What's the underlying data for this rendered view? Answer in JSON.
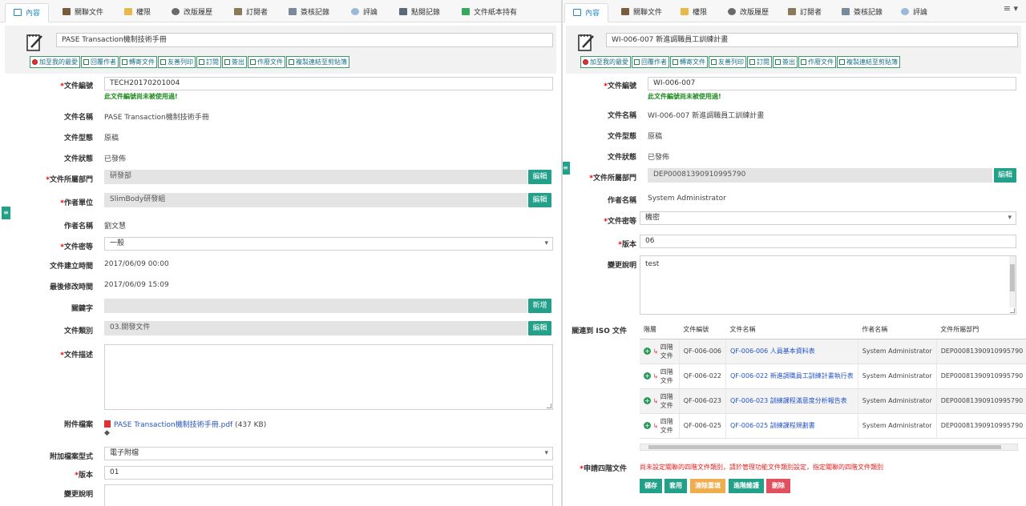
{
  "left": {
    "tabs": [
      "內容",
      "關聯文件",
      "權限",
      "改版履歷",
      "訂閱者",
      "簽核記錄",
      "評論",
      "點閱記錄",
      "文件紙本持有"
    ],
    "title": "PASE Transaction機制技術手冊",
    "actions": [
      "加至我的最愛",
      "回覆作者",
      "轉寄文件",
      "友善列印",
      "訂閱",
      "簽出",
      "作廢文件",
      "複製連結至剪貼簿"
    ],
    "fields": {
      "doc_no_label": "文件編號",
      "doc_no": "TECH20170201004",
      "doc_no_ok": "此文件編號尚未被使用過!",
      "doc_name_label": "文件名稱",
      "doc_name": "PASE Transaction機制技術手冊",
      "doc_type_label": "文件型態",
      "doc_type": "原稿",
      "doc_status_label": "文件狀態",
      "doc_status": "已發佈",
      "dept_label": "文件所屬部門",
      "dept": "研發部",
      "author_unit_label": "作者單位",
      "author_unit": "SlimBody研發組",
      "author_label": "作者名稱",
      "author": "劉文慧",
      "secrecy_label": "文件密等",
      "secrecy": "一般",
      "created_label": "文件建立時間",
      "created": "2017/06/09 00:00",
      "modified_label": "最後修改時間",
      "modified": "2017/06/09 15:09",
      "keywords_label": "關鍵字",
      "category_label": "文件類別",
      "category": "03.開發文件",
      "desc_label": "文件描述",
      "attachment_label": "附件檔案",
      "attachment_name": "PASE Transaction機制技術手冊.pdf",
      "attachment_size": "(437 KB)",
      "attach_format_label": "附加檔案型式",
      "attach_format": "電子附檔",
      "version_label": "版本",
      "version": "01",
      "change_label": "變更說明"
    },
    "buttons": {
      "edit": "編輯",
      "add": "新增"
    }
  },
  "right": {
    "tabs": [
      "內容",
      "關聯文件",
      "權限",
      "改版履歷",
      "訂閱者",
      "簽核記錄",
      "評論"
    ],
    "title": "WI-006-007 新進調職員工訓練計畫",
    "actions": [
      "加至我的最愛",
      "回覆作者",
      "轉寄文件",
      "友善列印",
      "訂閱",
      "簽出",
      "作廢文件",
      "複製連結至剪貼簿"
    ],
    "fields": {
      "doc_no_label": "文件編號",
      "doc_no": "WI-006-007",
      "doc_no_ok": "此文件編號尚未被使用過!",
      "doc_name_label": "文件名稱",
      "doc_name": "WI-006-007 新進調職員工訓練計畫",
      "doc_type_label": "文件型態",
      "doc_type": "原稿",
      "doc_status_label": "文件狀態",
      "doc_status": "已發佈",
      "dept_label": "文件所屬部門",
      "dept": "DEP00081390910995790",
      "author_label": "作者名稱",
      "author": "System Administrator",
      "secrecy_label": "文件密等",
      "secrecy": "機密",
      "version_label": "版本",
      "version": "06",
      "change_label": "變更說明",
      "change": "test",
      "iso_label": "關連到 ISO 文件",
      "apply_label": "申請四階文件",
      "apply_warning": "尚未設定關聯的四階文件類別，請於管理功能文件類別設定，指定關聯的四階文件類別"
    },
    "buttons": {
      "edit": "編輯"
    },
    "iso_table": {
      "headers": [
        "階層",
        "文件編號",
        "文件名稱",
        "作者名稱",
        "文件所屬部門"
      ],
      "level_text": "四階文件",
      "rows": [
        {
          "no": "QF-006-006",
          "name": "QF-006-006 人員基本資料表",
          "author": "System Administrator",
          "dept": "DEP00081390910995790"
        },
        {
          "no": "QF-006-022",
          "name": "QF-006-022 新進調職員工訓練計畫執行表",
          "author": "System Administrator",
          "dept": "DEP00081390910995790"
        },
        {
          "no": "QF-006-023",
          "name": "QF-006-023 訓練課程滿意度分析報告表",
          "author": "System Administrator",
          "dept": "DEP00081390910995790"
        },
        {
          "no": "QF-006-025",
          "name": "QF-006-025 訓練課程規劃書",
          "author": "System Administrator",
          "dept": "DEP00081390910995790"
        }
      ]
    },
    "footer_buttons": [
      "儲存",
      "套用",
      "清除重填",
      "進階維護",
      "刪除"
    ],
    "footer_colors": [
      "#22a08a",
      "#22a08a",
      "#f0ad4e",
      "#22a08a",
      "#e0505f"
    ]
  }
}
